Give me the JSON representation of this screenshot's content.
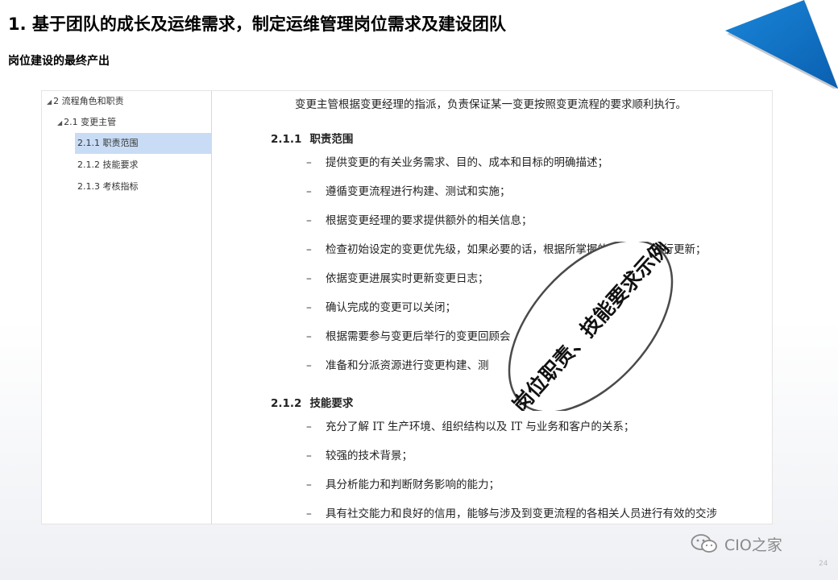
{
  "slide": {
    "title": "1. 基于团队的成长及运维需求，制定运维管理岗位需求及建设团队",
    "subtitle": "岗位建设的最终产出",
    "page_number": "24",
    "watermark": "CIO之家",
    "accent_color": "#0a6cc4"
  },
  "nav": {
    "items": [
      {
        "label": "2 流程角色和职责",
        "expanded": true
      },
      {
        "label": "2.1 变更主管",
        "expanded": true
      },
      {
        "label": "2.1.1 职责范围",
        "selected": true
      },
      {
        "label": "2.1.2 技能要求"
      },
      {
        "label": "2.1.3 考核指标"
      }
    ]
  },
  "doc": {
    "intro": "变更主管根据变更经理的指派，负责保证某一变更按照变更流程的要求顺利执行。",
    "sections": [
      {
        "num": "2.1.1",
        "title": "职责范围",
        "bullets": [
          "提供变更的有关业务需求、目的、成本和目标的明确描述；",
          "遵循变更流程进行构建、测试和实施；",
          "根据变更经理的要求提供额外的相关信息；",
          "检查初始设定的变更优先级，如果必要的话，根据所掌握的最新情况进行更新；",
          "依据变更进展实时更新变更日志；",
          "确认完成的变更可以关闭；",
          "根据需要参与变更后举行的变更回顾会",
          "准备和分派资源进行变更构建、测"
        ]
      },
      {
        "num": "2.1.2",
        "title": "技能要求",
        "bullets": [
          "充分了解 IT 生产环境、组织结构以及 IT 与业务和客户的关系；",
          "较强的技术背景；",
          "具分析能力和判断财务影响的能力；",
          "具有社交能力和良好的信用，能够与涉及到变更流程的各相关人员进行有效的交涉"
        ]
      }
    ],
    "dash": "–"
  },
  "callout": {
    "text": "岗位职责、技能要求示例"
  }
}
